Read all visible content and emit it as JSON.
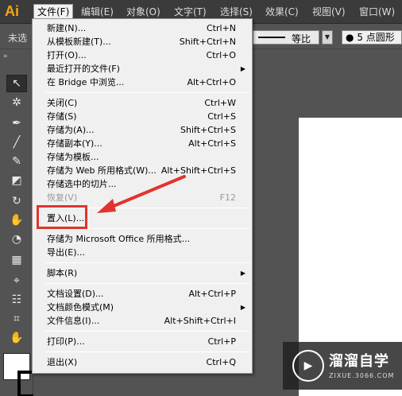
{
  "app": {
    "logo": "Ai"
  },
  "menubar": {
    "items": [
      {
        "label": "文件(F)"
      },
      {
        "label": "编辑(E)"
      },
      {
        "label": "对象(O)"
      },
      {
        "label": "文字(T)"
      },
      {
        "label": "选择(S)"
      },
      {
        "label": "效果(C)"
      },
      {
        "label": "视图(V)"
      },
      {
        "label": "窗口(W)"
      }
    ]
  },
  "controlbar": {
    "selection_status": "未选",
    "stroke_profile": "等比",
    "brush": "5 点圆形"
  },
  "file_menu": {
    "items": [
      {
        "label": "新建(N)...",
        "shortcut": "Ctrl+N"
      },
      {
        "label": "从模板新建(T)...",
        "shortcut": "Shift+Ctrl+N"
      },
      {
        "label": "打开(O)...",
        "shortcut": "Ctrl+O"
      },
      {
        "label": "最近打开的文件(F)",
        "shortcut": ""
      },
      {
        "label": "在 Bridge 中浏览...",
        "shortcut": "Alt+Ctrl+O"
      },
      {
        "label": "关闭(C)",
        "shortcut": "Ctrl+W"
      },
      {
        "label": "存储(S)",
        "shortcut": "Ctrl+S"
      },
      {
        "label": "存储为(A)...",
        "shortcut": "Shift+Ctrl+S"
      },
      {
        "label": "存储副本(Y)...",
        "shortcut": "Alt+Ctrl+S"
      },
      {
        "label": "存储为模板...",
        "shortcut": ""
      },
      {
        "label": "存储为 Web 所用格式(W)...",
        "shortcut": "Alt+Shift+Ctrl+S"
      },
      {
        "label": "存储选中的切片...",
        "shortcut": ""
      },
      {
        "label": "恢复(V)",
        "shortcut": "F12"
      },
      {
        "label": "置入(L)...",
        "shortcut": ""
      },
      {
        "label": "存储为 Microsoft Office 所用格式...",
        "shortcut": ""
      },
      {
        "label": "导出(E)...",
        "shortcut": ""
      },
      {
        "label": "脚本(R)",
        "shortcut": ""
      },
      {
        "label": "文档设置(D)...",
        "shortcut": "Alt+Ctrl+P"
      },
      {
        "label": "文档颜色模式(M)",
        "shortcut": ""
      },
      {
        "label": "文件信息(I)...",
        "shortcut": "Alt+Shift+Ctrl+I"
      },
      {
        "label": "打印(P)...",
        "shortcut": "Ctrl+P"
      },
      {
        "label": "退出(X)",
        "shortcut": "Ctrl+Q"
      }
    ]
  },
  "tools": [
    {
      "name": "selection-tool",
      "glyph": "↖"
    },
    {
      "name": "magic-wand-tool",
      "glyph": "✲"
    },
    {
      "name": "pen-tool",
      "glyph": "✒"
    },
    {
      "name": "line-segment-tool",
      "glyph": "╱"
    },
    {
      "name": "paintbrush-tool",
      "glyph": "✎"
    },
    {
      "name": "eraser-tool",
      "glyph": "◩"
    },
    {
      "name": "rotate-tool",
      "glyph": "↻"
    },
    {
      "name": "warp-tool",
      "glyph": "✋"
    },
    {
      "name": "shape-builder-tool",
      "glyph": "◔"
    },
    {
      "name": "perspective-grid-tool",
      "glyph": "▦"
    },
    {
      "name": "eyedropper-tool",
      "glyph": "⌖"
    },
    {
      "name": "symbol-sprayer-tool",
      "glyph": "☷"
    },
    {
      "name": "artboard-tool",
      "glyph": "⌗"
    },
    {
      "name": "hand-tool",
      "glyph": "✋"
    }
  ],
  "watermark": {
    "title": "溜溜自学",
    "subtitle": "ZIXUE.3066.COM"
  },
  "colors": {
    "highlight": "#e0342c",
    "logo": "#f7a21c",
    "menu_bg": "#f0f0f0",
    "ui_dark": "#535353"
  }
}
